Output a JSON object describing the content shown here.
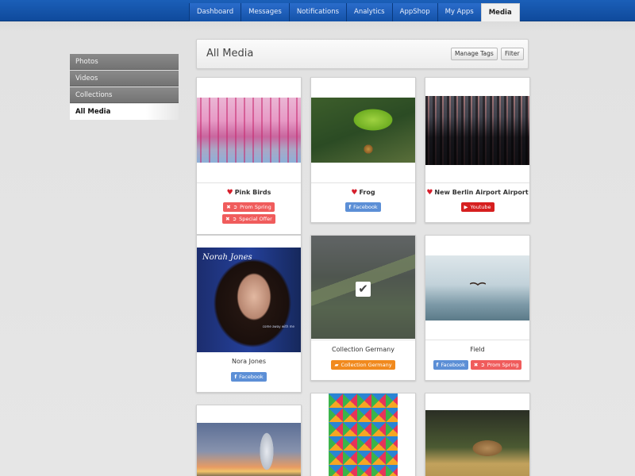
{
  "nav": {
    "tabs": [
      {
        "label": "Dashboard"
      },
      {
        "label": "Messages"
      },
      {
        "label": "Notifications"
      },
      {
        "label": "Analytics"
      },
      {
        "label": "AppShop"
      },
      {
        "label": "My Apps"
      },
      {
        "label": "Media",
        "active": true
      }
    ]
  },
  "sidebar": {
    "items": [
      {
        "label": "Photos"
      },
      {
        "label": "Videos"
      },
      {
        "label": "Collections"
      },
      {
        "label": "All Media",
        "active": true
      }
    ]
  },
  "header": {
    "title": "All Media",
    "manage_tags_label": "Manage Tags",
    "filter_label": "Filter"
  },
  "cards": [
    {
      "title": "Pink Birds",
      "favorite": true,
      "image": "flamingo-photo",
      "tags": [
        {
          "icons": "remove-icon tag-icon",
          "label": "Prom Spring",
          "style": "red"
        },
        {
          "icons": "remove-icon tag-icon",
          "label": "Special Offer",
          "style": "red"
        }
      ]
    },
    {
      "title": "Frog",
      "favorite": true,
      "image": "frog-photo",
      "tags": [
        {
          "icons": "facebook-icon",
          "label": "Facebook",
          "style": "fb"
        }
      ]
    },
    {
      "title": "New Berlin Airport Airport",
      "favorite": true,
      "image": "airport-photo",
      "tags": [
        {
          "icons": "youtube-icon",
          "label": "Youtube",
          "style": "yt"
        }
      ]
    },
    {
      "title": "Nora Jones",
      "favorite": false,
      "image": "album-cover",
      "cover_text": "Norah Jones",
      "cover_sub": "come away with me",
      "tags": [
        {
          "icons": "facebook-icon",
          "label": "Facebook",
          "style": "fb"
        }
      ]
    },
    {
      "title": "Collection Germany",
      "favorite": false,
      "image": "landscape-photo",
      "selected": true,
      "tags": [
        {
          "icons": "folder-icon",
          "label": "Collection Germany",
          "style": "orange"
        }
      ]
    },
    {
      "title": "Field",
      "favorite": false,
      "image": "seabird-photo",
      "tags": [
        {
          "icons": "facebook-icon",
          "label": "Facebook",
          "style": "fb"
        },
        {
          "icons": "remove-icon tag-icon",
          "label": "Prom Spring",
          "style": "red"
        }
      ]
    },
    {
      "title": "",
      "image": "geyser-photo"
    },
    {
      "title": "",
      "image": "mosaic-artwork"
    },
    {
      "title": "",
      "image": "coyote-photo"
    }
  ],
  "colors": {
    "nav_blue": "#1452a8",
    "tag_red": "#f05c5c",
    "facebook_blue": "#5c8fd6",
    "youtube_red": "#d61f1f",
    "collection_orange": "#f18a1e",
    "heart_red": "#d61f2c"
  }
}
